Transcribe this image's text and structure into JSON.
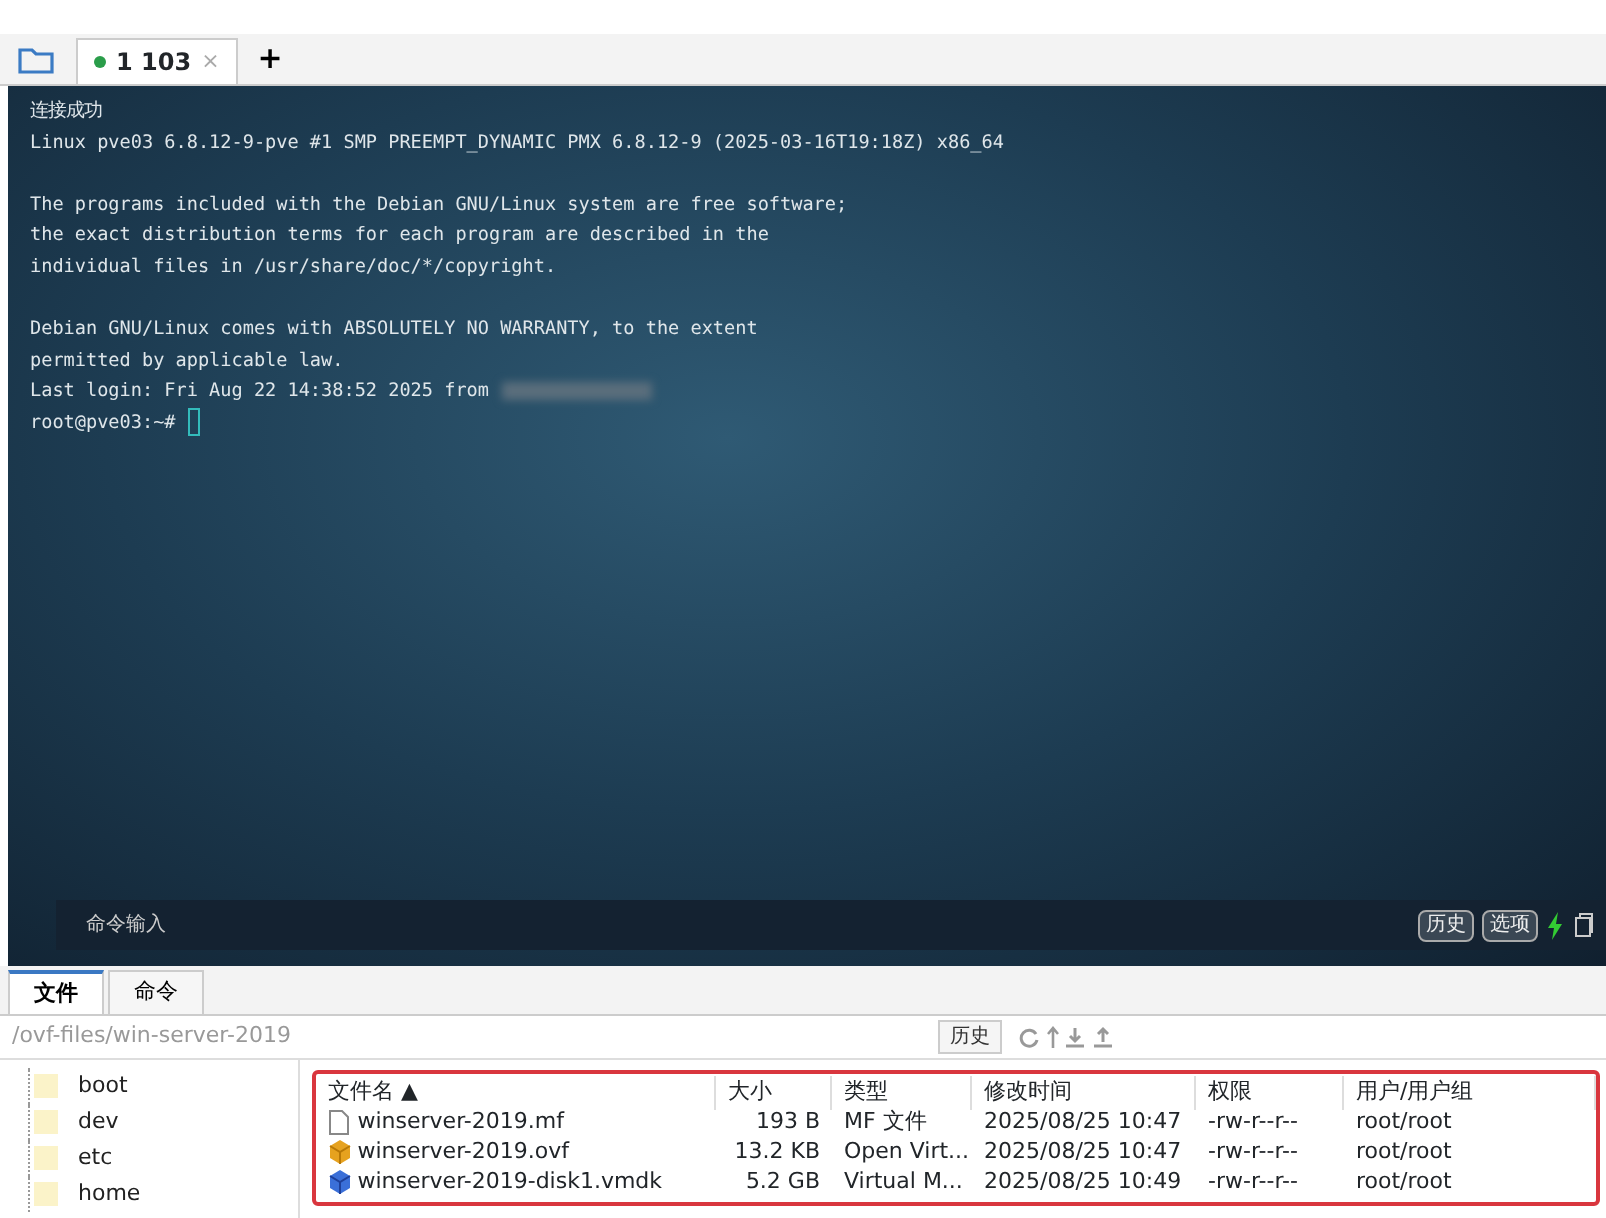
{
  "session_tabs": [
    {
      "label": "1 103",
      "connected": true,
      "selected": true,
      "close": "×"
    }
  ],
  "new_tab": "+",
  "terminal": {
    "blocks": [
      [
        "连接成功",
        "Linux pve03 6.8.12-9-pve #1 SMP PREEMPT_DYNAMIC PMX 6.8.12-9 (2025-03-16T19:18Z) x86_64"
      ],
      [
        "The programs included with the Debian GNU/Linux system are free software;",
        "the exact distribution terms for each program are described in the",
        "individual files in /usr/share/doc/*/copyright."
      ],
      [
        "Debian GNU/Linux comes with ABSOLUTELY NO WARRANTY, to the extent",
        "permitted by applicable law.",
        "Last login: Fri Aug 22 14:38:52 2025 from",
        "root@pve03:~#"
      ]
    ]
  },
  "command_bar": {
    "placeholder": "命令输入",
    "buttons": [
      "历史",
      "选项"
    ]
  },
  "bottom_tabs": [
    {
      "label": "文件",
      "selected": true
    },
    {
      "label": "命令",
      "selected": false
    }
  ],
  "path": "/ovf-files/win-server-2019",
  "history_button": "历史",
  "tree": [
    "boot",
    "dev",
    "etc",
    "home"
  ],
  "file_table": {
    "columns": [
      "文件名 ▲",
      "大小",
      "类型",
      "修改时间",
      "权限",
      "用户/用户组"
    ],
    "rows": [
      {
        "kind": "text",
        "cells": [
          "winserver-2019.mf",
          "193 B",
          "MF 文件",
          "2025/08/25 10:47",
          "-rw-r--r--",
          "root/root"
        ]
      },
      {
        "kind": "ovf",
        "cells": [
          "winserver-2019.ovf",
          "13.2 KB",
          "Open Virt...",
          "2025/08/25 10:47",
          "-rw-r--r--",
          "root/root"
        ]
      },
      {
        "kind": "vmdk",
        "cells": [
          "winserver-2019-disk1.vmdk",
          "5.2 GB",
          "Virtual M...",
          "2025/08/25 10:49",
          "-rw-r--r--",
          "root/root"
        ]
      }
    ]
  }
}
